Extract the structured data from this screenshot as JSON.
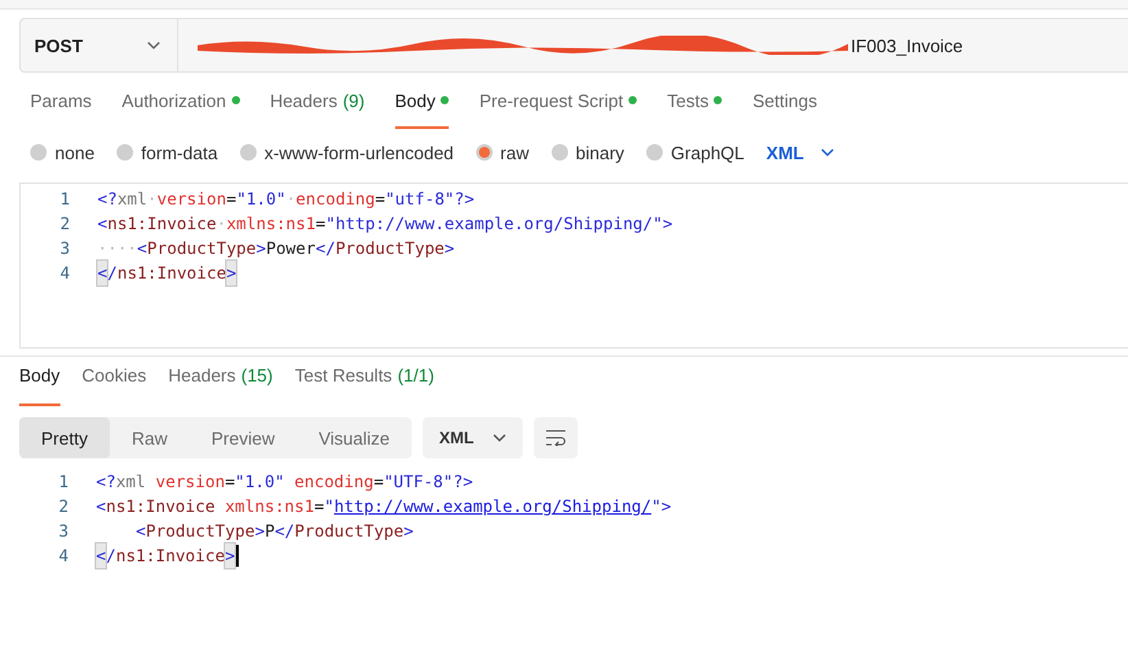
{
  "request": {
    "method": "POST",
    "url_visible": "IF003_Invoice",
    "url_redacted": true
  },
  "request_tabs": [
    {
      "label": "Params",
      "dot": false,
      "selected": false
    },
    {
      "label": "Authorization",
      "dot": true,
      "selected": false
    },
    {
      "label": "Headers",
      "count": "(9)",
      "dot": false,
      "selected": false
    },
    {
      "label": "Body",
      "dot": true,
      "selected": true
    },
    {
      "label": "Pre-request Script",
      "dot": true,
      "selected": false
    },
    {
      "label": "Tests",
      "dot": true,
      "selected": false
    },
    {
      "label": "Settings",
      "dot": false,
      "selected": false
    }
  ],
  "body_types": [
    {
      "label": "none",
      "selected": false
    },
    {
      "label": "form-data",
      "selected": false
    },
    {
      "label": "x-www-form-urlencoded",
      "selected": false
    },
    {
      "label": "raw",
      "selected": true
    },
    {
      "label": "binary",
      "selected": false
    },
    {
      "label": "GraphQL",
      "selected": false
    }
  ],
  "body_format": "XML",
  "request_body": [
    {
      "number": "1",
      "tokens": [
        {
          "t": "<?",
          "kind": "punct"
        },
        {
          "t": "xml",
          "kind": "decl"
        },
        {
          "t": "·",
          "kind": "ws"
        },
        {
          "t": "version",
          "kind": "attr"
        },
        {
          "t": "=",
          "kind": "plain"
        },
        {
          "t": "\"1.0\"",
          "kind": "str"
        },
        {
          "t": "·",
          "kind": "ws"
        },
        {
          "t": "encoding",
          "kind": "attr"
        },
        {
          "t": "=",
          "kind": "plain"
        },
        {
          "t": "\"utf-8\"",
          "kind": "str"
        },
        {
          "t": "?>",
          "kind": "punct"
        }
      ]
    },
    {
      "number": "2",
      "tokens": [
        {
          "t": "<",
          "kind": "punct"
        },
        {
          "t": "ns1:Invoice",
          "kind": "tag"
        },
        {
          "t": "·",
          "kind": "ws"
        },
        {
          "t": "xmlns:ns1",
          "kind": "attr"
        },
        {
          "t": "=",
          "kind": "plain"
        },
        {
          "t": "\"http://www.example.org/Shipping/\"",
          "kind": "str"
        },
        {
          "t": ">",
          "kind": "punct"
        }
      ]
    },
    {
      "number": "3",
      "tokens": [
        {
          "t": "····",
          "kind": "ws"
        },
        {
          "t": "<",
          "kind": "punct"
        },
        {
          "t": "ProductType",
          "kind": "tag"
        },
        {
          "t": ">",
          "kind": "punct"
        },
        {
          "t": "Power",
          "kind": "plain"
        },
        {
          "t": "</",
          "kind": "punct"
        },
        {
          "t": "ProductType",
          "kind": "tag"
        },
        {
          "t": ">",
          "kind": "punct"
        }
      ]
    },
    {
      "number": "4",
      "tokens": [
        {
          "t": "<",
          "kind": "match"
        },
        {
          "t": "/",
          "kind": "punct"
        },
        {
          "t": "ns1:Invoice",
          "kind": "tag"
        },
        {
          "t": ">",
          "kind": "match"
        }
      ]
    }
  ],
  "response_tabs": [
    {
      "label": "Body",
      "selected": true
    },
    {
      "label": "Cookies",
      "selected": false
    },
    {
      "label": "Headers",
      "count": "(15)",
      "selected": false
    },
    {
      "label": "Test Results",
      "count": "(1/1)",
      "selected": false
    }
  ],
  "view_modes": [
    {
      "label": "Pretty",
      "selected": true
    },
    {
      "label": "Raw",
      "selected": false
    },
    {
      "label": "Preview",
      "selected": false
    },
    {
      "label": "Visualize",
      "selected": false
    }
  ],
  "response_format": "XML",
  "response_body": [
    {
      "number": "1",
      "tokens": [
        {
          "t": "<?",
          "kind": "punct"
        },
        {
          "t": "xml",
          "kind": "decl"
        },
        {
          "t": " version",
          "kind": "attr"
        },
        {
          "t": "=",
          "kind": "plain"
        },
        {
          "t": "\"1.0\"",
          "kind": "str"
        },
        {
          "t": " encoding",
          "kind": "attr"
        },
        {
          "t": "=",
          "kind": "plain"
        },
        {
          "t": "\"UTF-8\"",
          "kind": "str"
        },
        {
          "t": "?>",
          "kind": "punct"
        }
      ]
    },
    {
      "number": "2",
      "tokens": [
        {
          "t": "<",
          "kind": "punct"
        },
        {
          "t": "ns1:Invoice",
          "kind": "tag"
        },
        {
          "t": " xmlns:ns1",
          "kind": "attr"
        },
        {
          "t": "=",
          "kind": "plain"
        },
        {
          "t": "\"",
          "kind": "str"
        },
        {
          "t": "http://www.example.org/Shipping/",
          "kind": "link"
        },
        {
          "t": "\"",
          "kind": "str"
        },
        {
          "t": ">",
          "kind": "punct"
        }
      ]
    },
    {
      "number": "3",
      "indented": true,
      "tokens": [
        {
          "t": "<",
          "kind": "punct"
        },
        {
          "t": "ProductType",
          "kind": "tag"
        },
        {
          "t": ">",
          "kind": "punct"
        },
        {
          "t": "P",
          "kind": "plain"
        },
        {
          "t": "</",
          "kind": "punct"
        },
        {
          "t": "ProductType",
          "kind": "tag"
        },
        {
          "t": ">",
          "kind": "punct"
        }
      ]
    },
    {
      "number": "4",
      "cursor": true,
      "tokens": [
        {
          "t": "<",
          "kind": "match"
        },
        {
          "t": "/",
          "kind": "punct"
        },
        {
          "t": "ns1:Invoice",
          "kind": "tag"
        },
        {
          "t": ">",
          "kind": "match"
        }
      ]
    }
  ]
}
